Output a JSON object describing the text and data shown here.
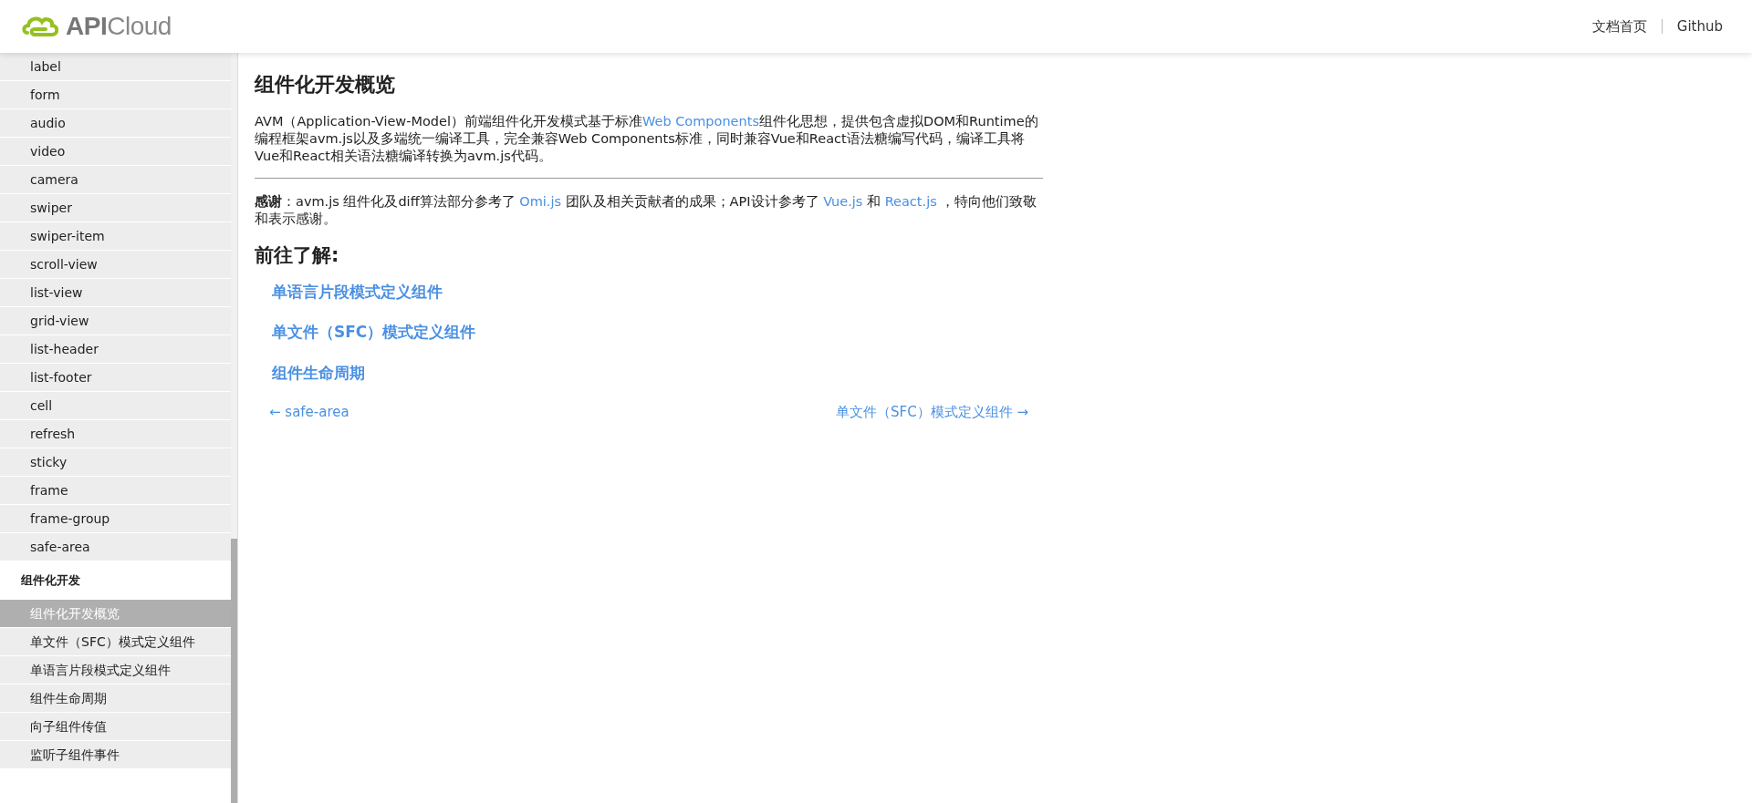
{
  "header": {
    "logo": "**API**Cloud",
    "links": [
      "文档首页",
      "Github"
    ]
  },
  "sidebar": {
    "items": [
      {
        "kind": "item",
        "label": "label",
        "selected": false
      },
      {
        "kind": "item",
        "label": "form",
        "selected": false
      },
      {
        "kind": "item",
        "label": "audio",
        "selected": false
      },
      {
        "kind": "item",
        "label": "video",
        "selected": false
      },
      {
        "kind": "item",
        "label": "camera",
        "selected": false
      },
      {
        "kind": "item",
        "label": "swiper",
        "selected": false
      },
      {
        "kind": "item",
        "label": "swiper-item",
        "selected": false
      },
      {
        "kind": "item",
        "label": "scroll-view",
        "selected": false
      },
      {
        "kind": "item",
        "label": "list-view",
        "selected": false
      },
      {
        "kind": "item",
        "label": "grid-view",
        "selected": false
      },
      {
        "kind": "item",
        "label": "list-header",
        "selected": false
      },
      {
        "kind": "item",
        "label": "list-footer",
        "selected": false
      },
      {
        "kind": "item",
        "label": "cell",
        "selected": false
      },
      {
        "kind": "item",
        "label": "refresh",
        "selected": false
      },
      {
        "kind": "item",
        "label": "sticky",
        "selected": false
      },
      {
        "kind": "item",
        "label": "frame",
        "selected": false
      },
      {
        "kind": "item",
        "label": "frame-group",
        "selected": false
      },
      {
        "kind": "item",
        "label": "safe-area",
        "selected": false
      },
      {
        "kind": "section",
        "label": "组件化开发"
      },
      {
        "kind": "item",
        "label": "组件化开发概览",
        "selected": true
      },
      {
        "kind": "item",
        "label": "单文件（SFC）模式定义组件",
        "selected": false
      },
      {
        "kind": "item",
        "label": "单语言片段模式定义组件",
        "selected": false
      },
      {
        "kind": "item",
        "label": "组件生命周期",
        "selected": false
      },
      {
        "kind": "item",
        "label": "向子组件传值",
        "selected": false
      },
      {
        "kind": "item",
        "label": "监听子组件事件",
        "selected": false
      }
    ]
  },
  "content": {
    "title": "组件化开发概览",
    "intro": [
      {
        "text": "AVM（Application-View-Model）前端组件化开发模式基于标准"
      },
      {
        "link": "Web Components"
      },
      {
        "text": "组件化思想，提供包含虚拟DOM和Runtime的编程框架avm.js以及多端统一编译工具，完全兼容Web Components标准，同时兼容Vue和React语法糖编写代码，编译工具将Vue和React相关语法糖编译转换为avm.js代码。"
      }
    ],
    "thanks": [
      {
        "text": "**感谢**：avm.js 组件化及diff算法部分参考了 "
      },
      {
        "link": "Omi.js"
      },
      {
        "text": " 团队及相关贡献者的成果；API设计参考了 "
      },
      {
        "link": "Vue.js"
      },
      {
        "text": " 和 "
      },
      {
        "link": "React.js"
      },
      {
        "text": " ，特向他们致敬和表示感谢。"
      }
    ],
    "subtitle": "前往了解:",
    "links": [
      "单语言片段模式定义组件",
      "单文件（SFC）模式定义组件",
      "组件生命周期"
    ],
    "prev": "← safe-area",
    "next": "单文件（SFC）模式定义组件 →"
  }
}
